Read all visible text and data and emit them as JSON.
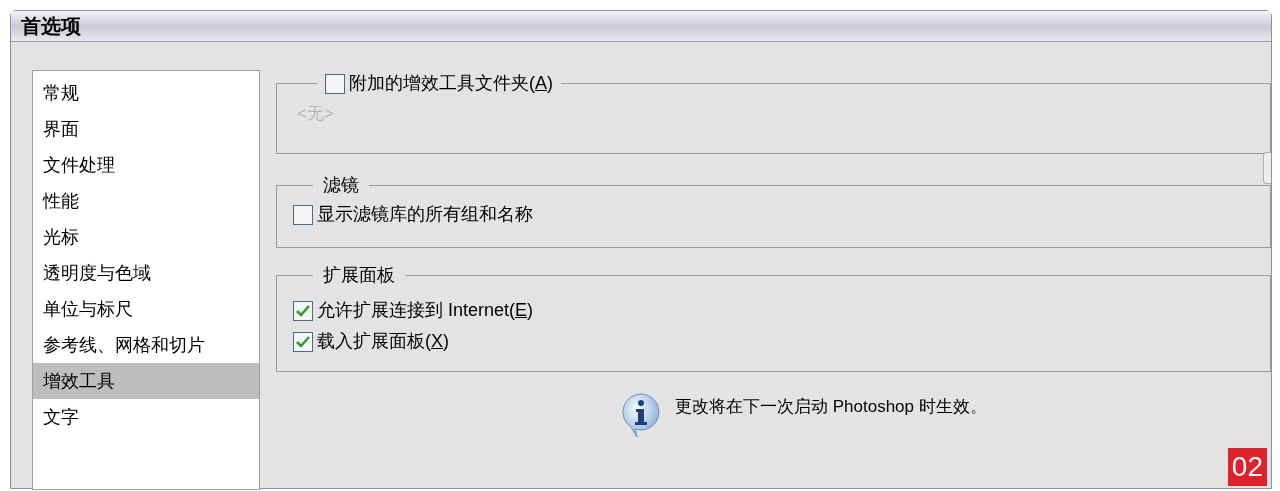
{
  "window": {
    "title": "首选项"
  },
  "sidebar": {
    "items": [
      {
        "label": "常规",
        "selected": false
      },
      {
        "label": "界面",
        "selected": false
      },
      {
        "label": "文件处理",
        "selected": false
      },
      {
        "label": "性能",
        "selected": false
      },
      {
        "label": "光标",
        "selected": false
      },
      {
        "label": "透明度与色域",
        "selected": false
      },
      {
        "label": "单位与标尺",
        "selected": false
      },
      {
        "label": "参考线、网格和切片",
        "selected": false
      },
      {
        "label": "增效工具",
        "selected": true
      },
      {
        "label": "文字",
        "selected": false
      }
    ]
  },
  "plugins_group": {
    "checkbox": {
      "text": "附加的增效工具文件夹(",
      "mnemonic": "A",
      "close": ")",
      "checked": false
    },
    "path_field": {
      "value": "<无>",
      "disabled": true
    }
  },
  "filters_group": {
    "title": "滤镜",
    "options": [
      {
        "text": "显示滤镜库的所有组和名称",
        "checked": false
      }
    ]
  },
  "extensions_group": {
    "title": "扩展面板",
    "options": [
      {
        "text": "允许扩展连接到 Internet(",
        "mnemonic": "E",
        "close": ")",
        "checked": true
      },
      {
        "text": "载入扩展面板(",
        "mnemonic": "X",
        "close": ")",
        "checked": true
      }
    ]
  },
  "notice": "更改将在下一次启动 Photoshop 时生效。",
  "figure_badge": "02"
}
